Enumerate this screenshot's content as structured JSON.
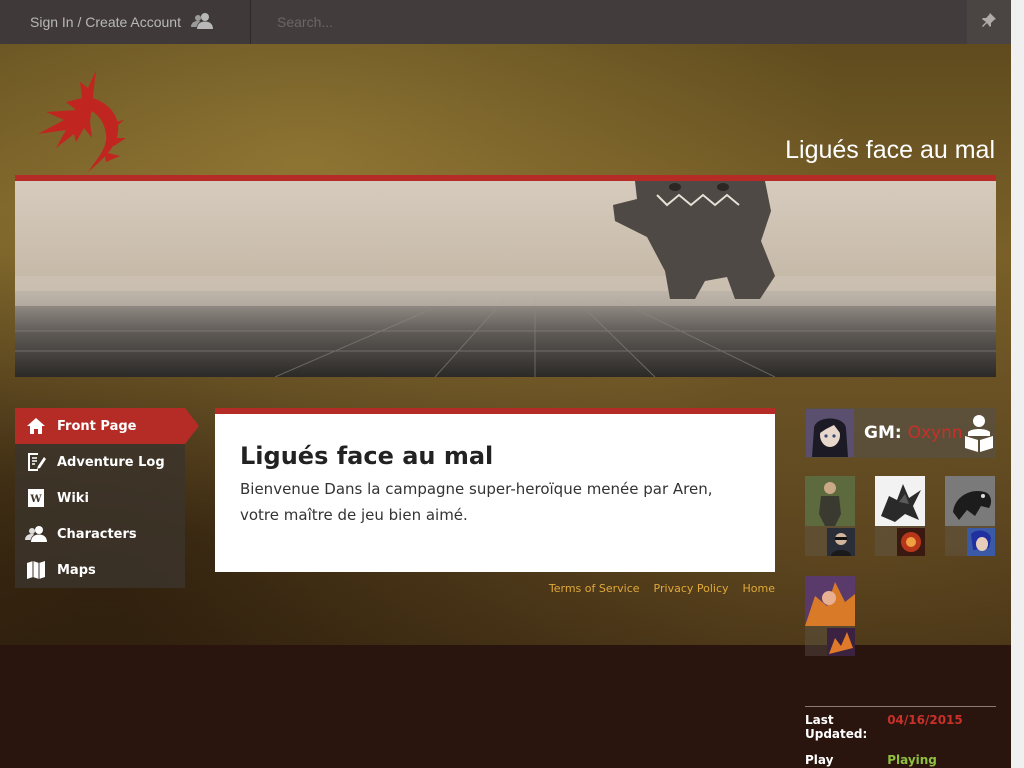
{
  "topbar": {
    "signin_label": "Sign In / Create Account",
    "search_placeholder": "Search..."
  },
  "site": {
    "title": "Ligués face au mal"
  },
  "nav": {
    "items": [
      {
        "label": "Front Page",
        "icon": "home-icon",
        "active": true
      },
      {
        "label": "Adventure Log",
        "icon": "document-edit-icon",
        "active": false
      },
      {
        "label": "Wiki",
        "icon": "wiki-icon",
        "active": false
      },
      {
        "label": "Characters",
        "icon": "users-icon",
        "active": false
      },
      {
        "label": "Maps",
        "icon": "map-icon",
        "active": false
      }
    ]
  },
  "content": {
    "title": "Ligués face au mal",
    "body": "Bienvenue Dans la campagne super-heroïque menée par Aren, votre maître de jeu bien aimé."
  },
  "footer": {
    "terms": "Terms of Service",
    "privacy": "Privacy Policy",
    "home": "Home"
  },
  "gm": {
    "label": "GM:",
    "name": "Oxynn"
  },
  "meta": {
    "last_updated_label_1": "Last",
    "last_updated_label_2": "Updated:",
    "last_updated_value": "04/16/2015",
    "play_status_label": "Play Status:",
    "play_status_value": "Playing"
  },
  "colors": {
    "accent": "#b52b26",
    "link": "#e0a93a",
    "status_playing": "#8fbf3f",
    "date": "#c8302a"
  }
}
